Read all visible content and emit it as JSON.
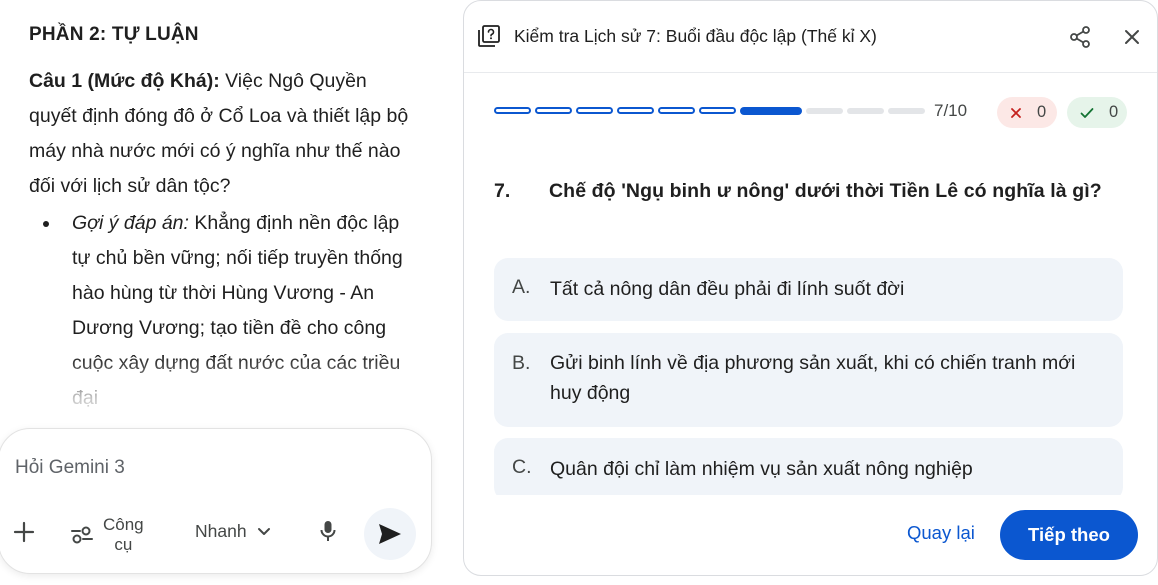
{
  "left": {
    "section_title": "PHẦN 2: TỰ LUẬN",
    "question_label": "Câu 1 (Mức độ Khá):",
    "question_text": " Việc Ngô Quyền quyết định đóng đô ở Cổ Loa và thiết lập bộ máy nhà nước mới có ý nghĩa như thế nào đối với lịch sử dân tộc?",
    "hint_label": "Gợi ý đáp án:",
    "hint_text": " Khẳng định nền độc lập tự chủ bền vững; nối tiếp truyền thống hào hùng từ thời Hùng Vương - An Dương Vương; tạo tiền đề cho công cuộc xây dựng đất nước của các triều đại"
  },
  "composer": {
    "placeholder": "Hỏi Gemini 3",
    "tools_label": "Công cụ",
    "speed_label": "Nhanh",
    "icons": [
      "plus-icon",
      "tools-icon",
      "chevron-down-icon",
      "mic-icon",
      "send-icon"
    ]
  },
  "quiz": {
    "title": "Kiểm tra Lịch sử 7: Buổi đầu độc lập (Thế kỉ X)",
    "progress": {
      "current": 7,
      "total": 10,
      "label": "7/10"
    },
    "wrong_count": "0",
    "correct_count": "0",
    "question_number": "7.",
    "question": "Chế độ 'Ngụ binh ư nông' dưới thời Tiền Lê có nghĩa là gì?",
    "options": [
      {
        "letter": "A.",
        "text": "Tất cả nông dân đều phải đi lính suốt đời"
      },
      {
        "letter": "B.",
        "text": "Gửi binh lính về địa phương sản xuất, khi có chiến tranh mới huy động"
      },
      {
        "letter": "C.",
        "text": "Quân đội chỉ làm nhiệm vụ sản xuất nông nghiệp"
      }
    ],
    "back_label": "Quay lại",
    "next_label": "Tiếp theo"
  },
  "colors": {
    "accent": "#0b57d0",
    "option_bg": "#f0f4f9",
    "wrong_bg": "#fce8e6",
    "right_bg": "#e6f4ea"
  }
}
